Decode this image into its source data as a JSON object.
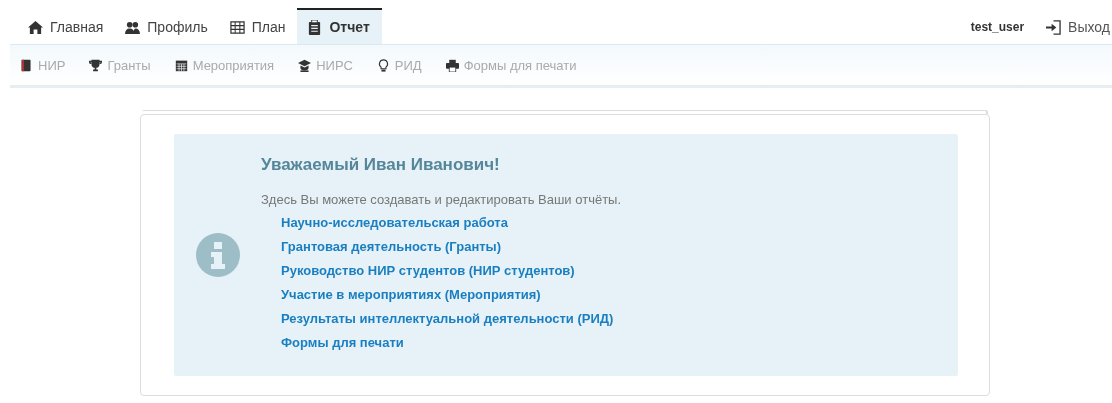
{
  "nav": {
    "tabs": [
      {
        "label": "Главная",
        "selected": false
      },
      {
        "label": "Профиль",
        "selected": false
      },
      {
        "label": "План",
        "selected": false
      },
      {
        "label": "Отчет",
        "selected": true
      }
    ],
    "user": "test_user",
    "logout": "Выход"
  },
  "subnav": {
    "items": [
      {
        "label": "НИР",
        "selected": false
      },
      {
        "label": "Гранты",
        "selected": false
      },
      {
        "label": "Мероприятия",
        "selected": false
      },
      {
        "label": "НИРС",
        "selected": false
      },
      {
        "label": "РИД",
        "selected": false
      },
      {
        "label": "Формы для печати",
        "selected": false
      }
    ]
  },
  "notice": {
    "title": "Уважаемый Иван Иванович!",
    "text": "Здесь Вы можете создавать и редактировать Ваши отчёты.",
    "links": [
      "Научно-исследовательская работа",
      "Грантовая деятельность (Гранты)",
      "Руководство НИР студентов (НИР студентов)",
      "Участие в мероприятиях (Мероприятия)",
      "Результаты интеллектуальной деятельности (РИД)",
      "Формы для печати"
    ]
  }
}
